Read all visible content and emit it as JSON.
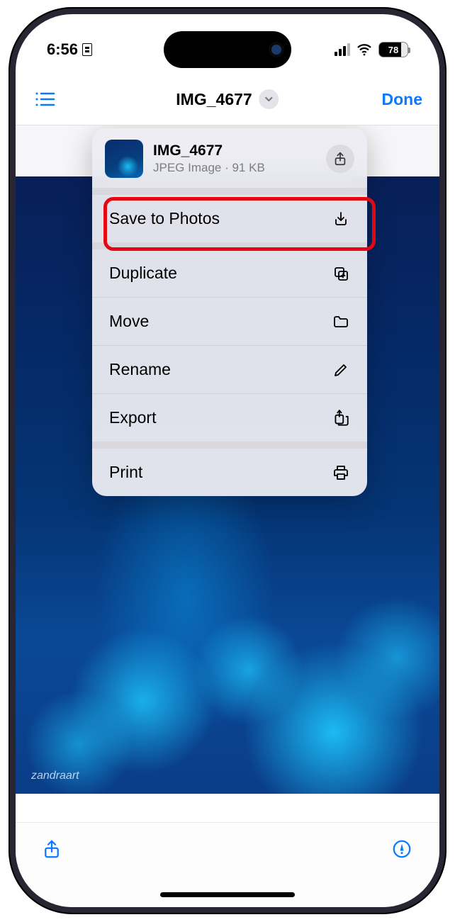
{
  "status": {
    "time": "6:56",
    "battery_pct": "78"
  },
  "nav": {
    "title": "IMG_4677",
    "done_label": "Done"
  },
  "menu": {
    "header": {
      "name": "IMG_4677",
      "meta": "JPEG Image · 91 KB"
    },
    "items_top": [
      {
        "label": "Save to Photos",
        "icon": "download"
      }
    ],
    "items_mid": [
      {
        "label": "Duplicate",
        "icon": "duplicate"
      },
      {
        "label": "Move",
        "icon": "folder"
      },
      {
        "label": "Rename",
        "icon": "pencil"
      },
      {
        "label": "Export",
        "icon": "export"
      }
    ],
    "items_bot": [
      {
        "label": "Print",
        "icon": "printer"
      }
    ]
  },
  "image": {
    "signature": "zandraart"
  }
}
